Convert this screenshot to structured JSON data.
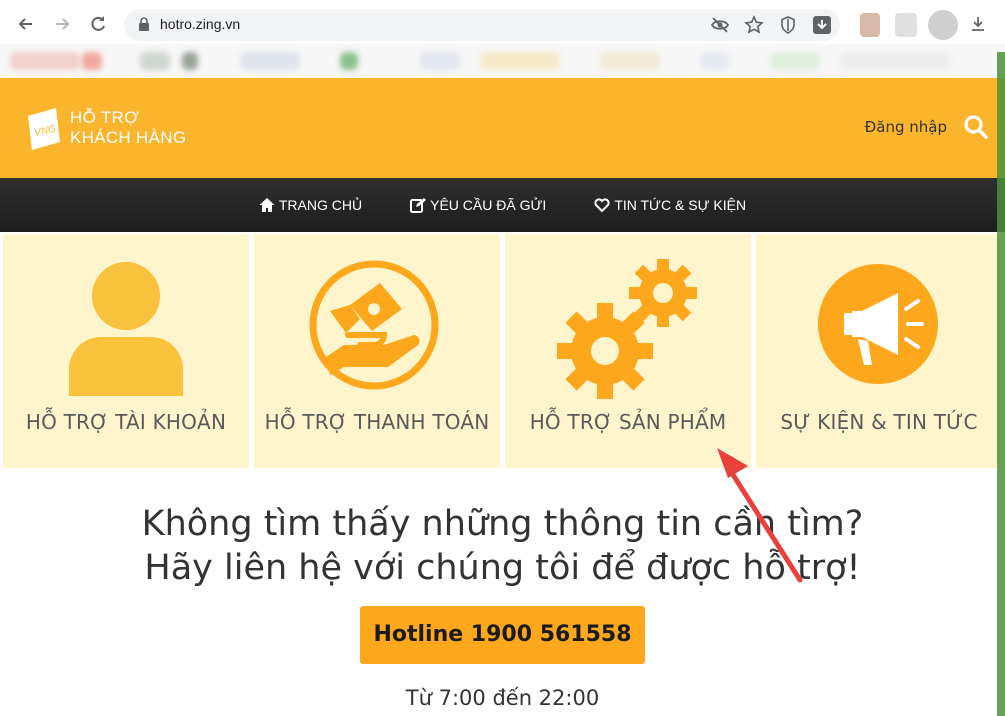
{
  "browser": {
    "url": "hotro.zing.vn"
  },
  "header": {
    "logo_mark": "VNG",
    "logo_line1": "HỖ TRỢ",
    "logo_line2": "KHÁCH HÀNG",
    "login_label": "Đăng nhập"
  },
  "nav": {
    "items": [
      {
        "label": "TRANG CHỦ",
        "icon": "home-icon"
      },
      {
        "label": "YÊU CẦU ĐÃ GỬI",
        "icon": "edit-icon"
      },
      {
        "label": "TIN TỨC & SỰ KIỆN",
        "icon": "heart-icon"
      }
    ]
  },
  "cards": [
    {
      "label": "HỖ TRỢ TÀI KHOẢN",
      "icon": "user-icon"
    },
    {
      "label": "HỖ TRỢ THANH TOÁN",
      "icon": "payment-icon"
    },
    {
      "label": "HỖ TRỢ SẢN PHẨM",
      "icon": "gears-icon"
    },
    {
      "label": "SỰ KIỆN & TIN TỨC",
      "icon": "megaphone-icon"
    }
  ],
  "contact": {
    "line1": "Không tìm thấy những thông tin cần tìm?",
    "line2": "Hãy liên hệ với chúng tôi để được hỗ trợ!",
    "hotline": "Hotline 1900 561558",
    "hours": "Từ 7:00 đến 22:00"
  },
  "colors": {
    "brand_yellow": "#fbb52d",
    "card_bg": "#fff5cc",
    "icon_orange": "#fca71c",
    "navbar": "#222222",
    "arrow_red": "#e8413b"
  }
}
